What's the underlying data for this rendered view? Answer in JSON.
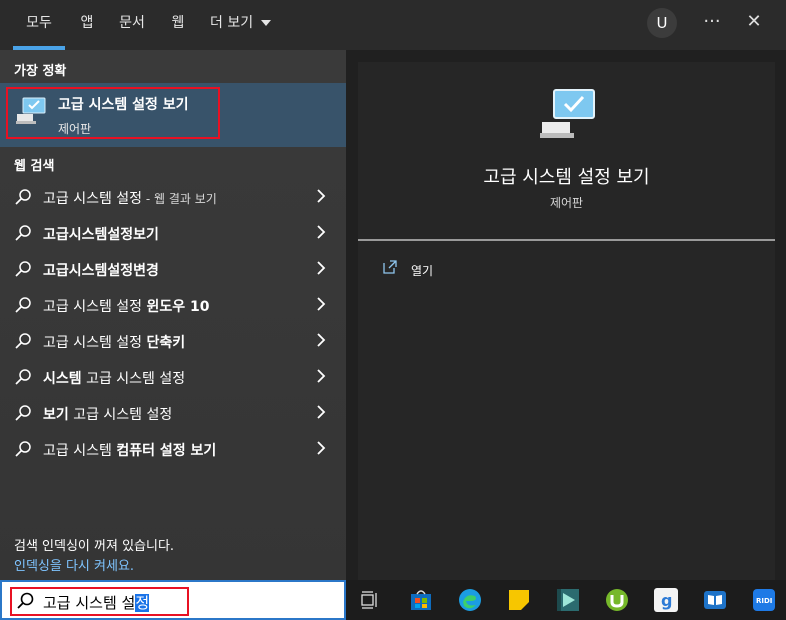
{
  "tabs": [
    "모두",
    "앱",
    "문서",
    "웹",
    "더 보기"
  ],
  "avatar_letter": "U",
  "more_label": "···",
  "close_label": "✕",
  "best_match": {
    "section_title": "가장 정확",
    "title": "고급 시스템 설정 보기",
    "subtitle": "제어판"
  },
  "web": {
    "section_title": "웹 검색",
    "items": [
      {
        "normal": "고급 시스템 설정",
        "bold": "",
        "suffix": " - 웹 결과 보기"
      },
      {
        "normal": "",
        "bold": "고급시스템설정보기",
        "suffix": ""
      },
      {
        "normal": "",
        "bold": "고급시스템설정변경",
        "suffix": ""
      },
      {
        "normal": "고급 시스템 설정 ",
        "bold": "윈도우 10",
        "suffix": ""
      },
      {
        "normal": "고급 시스템 설정 ",
        "bold": "단축키",
        "suffix": ""
      },
      {
        "bold": "시스템",
        "normal": " 고급 시스템 설정",
        "suffix": ""
      },
      {
        "bold": "보기",
        "normal": " 고급 시스템 설정",
        "suffix": ""
      },
      {
        "normal": "고급 시스템 ",
        "bold": "컴퓨터 설정 보기",
        "suffix": ""
      }
    ]
  },
  "indexing": {
    "line1": "검색 인덱싱이 꺼져 있습니다.",
    "line2": "인덱싱을 다시 켜세요."
  },
  "search": {
    "value_before": "고급 시스템 설",
    "value_selected": "정"
  },
  "preview": {
    "title": "고급 시스템 설정 보기",
    "subtitle": "제어판",
    "open_label": "열기"
  },
  "taskbar": {
    "icons": [
      "task-view-icon",
      "store-icon",
      "edge-icon",
      "sticky-notes-icon",
      "media-player-icon",
      "utorrent-icon",
      "g-app-icon",
      "book-icon",
      "ridi-icon"
    ]
  },
  "colors": {
    "accent": "#4aa3e8",
    "highlight_box": "#e81123",
    "best_match_bg": "#38536a",
    "link": "#7fc4ff"
  }
}
